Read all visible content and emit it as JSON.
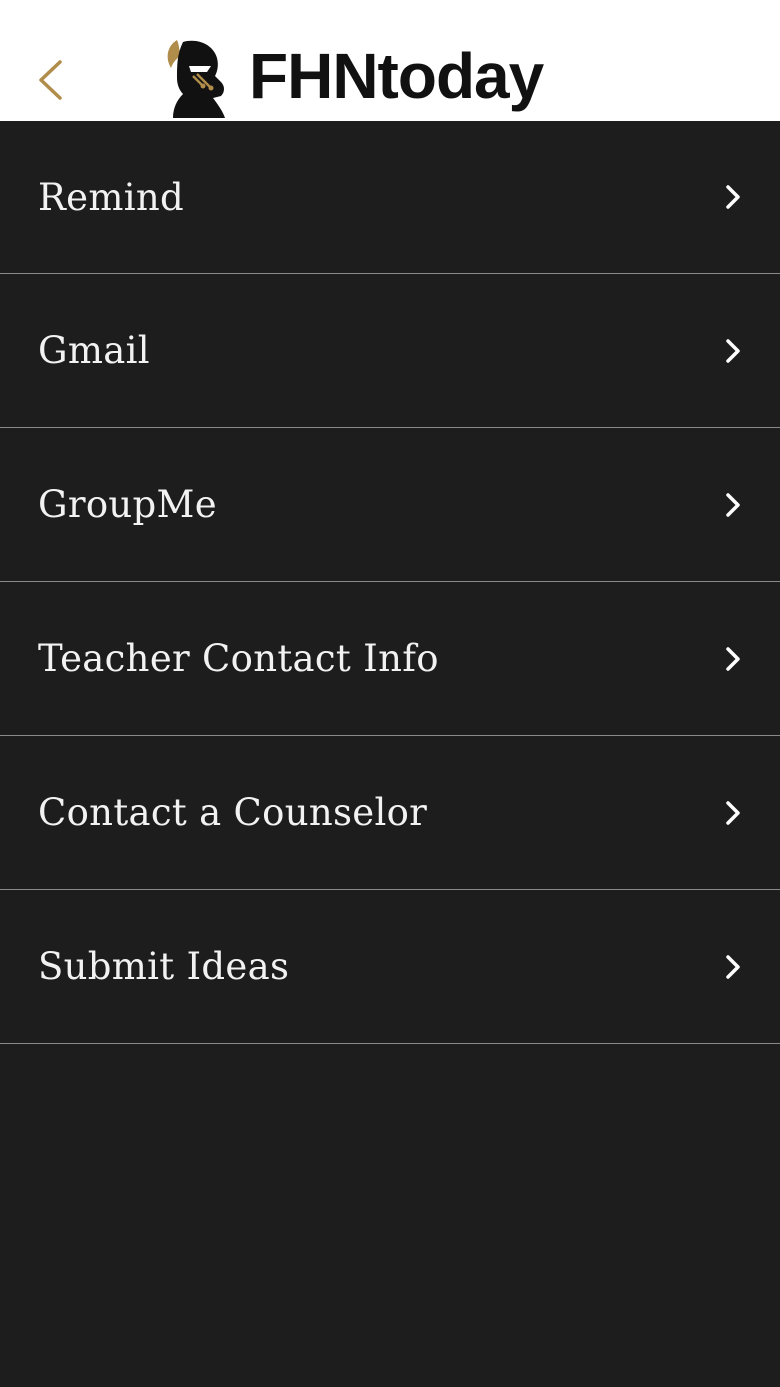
{
  "header": {
    "brand_name": "FHNtoday",
    "back_icon": "chevron-left-icon",
    "logo_icon": "knight-helmet-icon",
    "accent_color": "#b08d4a"
  },
  "menu": {
    "items": [
      {
        "label": "Remind"
      },
      {
        "label": "Gmail"
      },
      {
        "label": "GroupMe"
      },
      {
        "label": "Teacher Contact Info"
      },
      {
        "label": "Contact a Counselor"
      },
      {
        "label": "Submit Ideas"
      }
    ],
    "item_icon": "chevron-right-icon"
  },
  "colors": {
    "background": "#1d1d1d",
    "header_background": "#ffffff",
    "text": "#f2f2f2",
    "divider": "#8a8a8a"
  }
}
